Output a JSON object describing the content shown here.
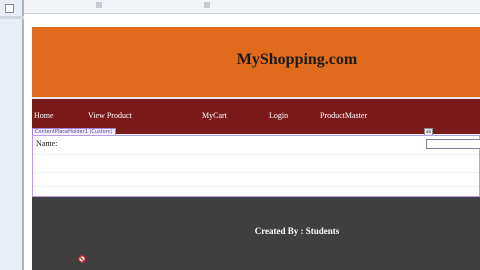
{
  "site": {
    "title": "MyShopping.com",
    "header_color": "#e06b1c",
    "nav_color": "#7b1a1a",
    "footer_color": "#3f3f3f"
  },
  "nav": {
    "items": [
      {
        "label": "Home"
      },
      {
        "label": "View Product"
      },
      {
        "label": "MyCart"
      },
      {
        "label": "Login"
      },
      {
        "label": "ProductMaster"
      }
    ]
  },
  "content": {
    "placeholder_tag": "ContentPlaceHolder1 (Custom)",
    "name_label": "Name:",
    "name_value": "",
    "input_tag_glyph": "ab"
  },
  "footer": {
    "text": "Created By : Students"
  }
}
